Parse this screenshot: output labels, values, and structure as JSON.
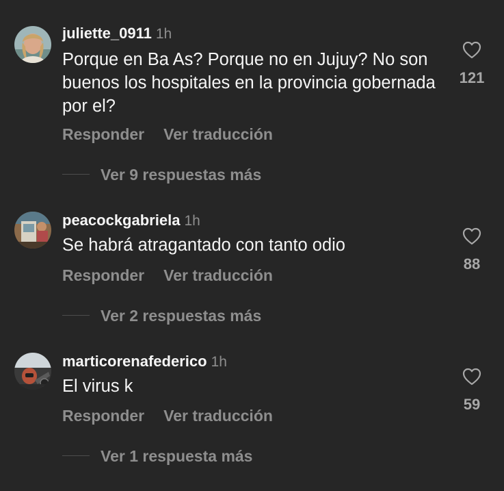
{
  "comments": [
    {
      "username": "juliette_0911",
      "time": "1h",
      "text": "Porque en Ba As? Porque no en Jujuy? No son buenos los hospitales en la provincia gobernada por el?",
      "reply_label": "Responder",
      "translate_label": "Ver traducción",
      "replies_label": "Ver 9 respuestas más",
      "likes": "121",
      "like_icon": "heart-outline"
    },
    {
      "username": "peacockgabriela",
      "time": "1h",
      "text": "Se habrá atragantado con tanto odio",
      "reply_label": "Responder",
      "translate_label": "Ver traducción",
      "replies_label": "Ver 2 respuestas más",
      "likes": "88",
      "like_icon": "heart-outline"
    },
    {
      "username": "marticorenafederico",
      "time": "1h",
      "text": "El virus k",
      "reply_label": "Responder",
      "translate_label": "Ver traducción",
      "replies_label": "Ver 1 respuesta más",
      "likes": "59",
      "like_icon": "heart-outline"
    }
  ],
  "colors": {
    "background": "#262626",
    "primary_text": "#f5f5f5",
    "secondary_text": "#8e8e8e"
  }
}
